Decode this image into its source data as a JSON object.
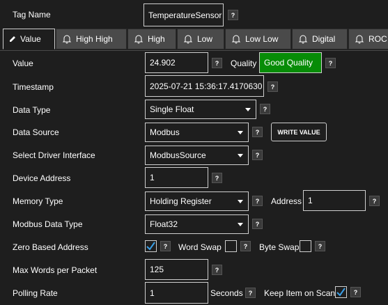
{
  "header": {
    "tag_name_label": "Tag Name",
    "tag_name_value": "TemperatureSensor"
  },
  "help_glyph": "?",
  "tabs": [
    {
      "label": "Value",
      "icon": "pencil-icon",
      "active": true
    },
    {
      "label": "High High",
      "icon": "bell-icon"
    },
    {
      "label": "High",
      "icon": "bell-icon"
    },
    {
      "label": "Low",
      "icon": "bell-icon"
    },
    {
      "label": "Low Low",
      "icon": "bell-icon"
    },
    {
      "label": "Digital",
      "icon": "bell-icon"
    },
    {
      "label": "ROC",
      "icon": "bell-icon"
    }
  ],
  "form": {
    "value": {
      "label": "Value",
      "value": "24.902"
    },
    "quality": {
      "label": "Quality",
      "value": "Good Quality",
      "color": "#078c07"
    },
    "timestamp": {
      "label": "Timestamp",
      "value": "2025-07-21 15:36:17.4170630"
    },
    "data_type": {
      "label": "Data Type",
      "value": "Single Float"
    },
    "data_source": {
      "label": "Data Source",
      "value": "Modbus"
    },
    "write_value_button": "WRITE VALUE",
    "driver_interface": {
      "label": "Select Driver Interface",
      "value": "ModbusSource"
    },
    "device_address": {
      "label": "Device Address",
      "value": "1"
    },
    "memory_type": {
      "label": "Memory Type",
      "value": "Holding Register"
    },
    "address": {
      "label": "Address",
      "value": "1"
    },
    "modbus_data_type": {
      "label": "Modbus Data Type",
      "value": "Float32"
    },
    "zero_based_address": {
      "label": "Zero Based Address",
      "checked": true
    },
    "word_swap": {
      "label": "Word Swap",
      "checked": false
    },
    "byte_swap": {
      "label": "Byte Swap",
      "checked": false
    },
    "max_words": {
      "label": "Max Words per Packet",
      "value": "125"
    },
    "polling_rate": {
      "label": "Polling Rate",
      "value": "1",
      "unit": "Seconds"
    },
    "keep_item_on_scan": {
      "label": "Keep Item on Scan",
      "checked": true
    }
  },
  "colors": {
    "background": "#1e1e1e",
    "tab_inactive": "#4a4a4a",
    "check_blue": "#3aa0e8"
  }
}
